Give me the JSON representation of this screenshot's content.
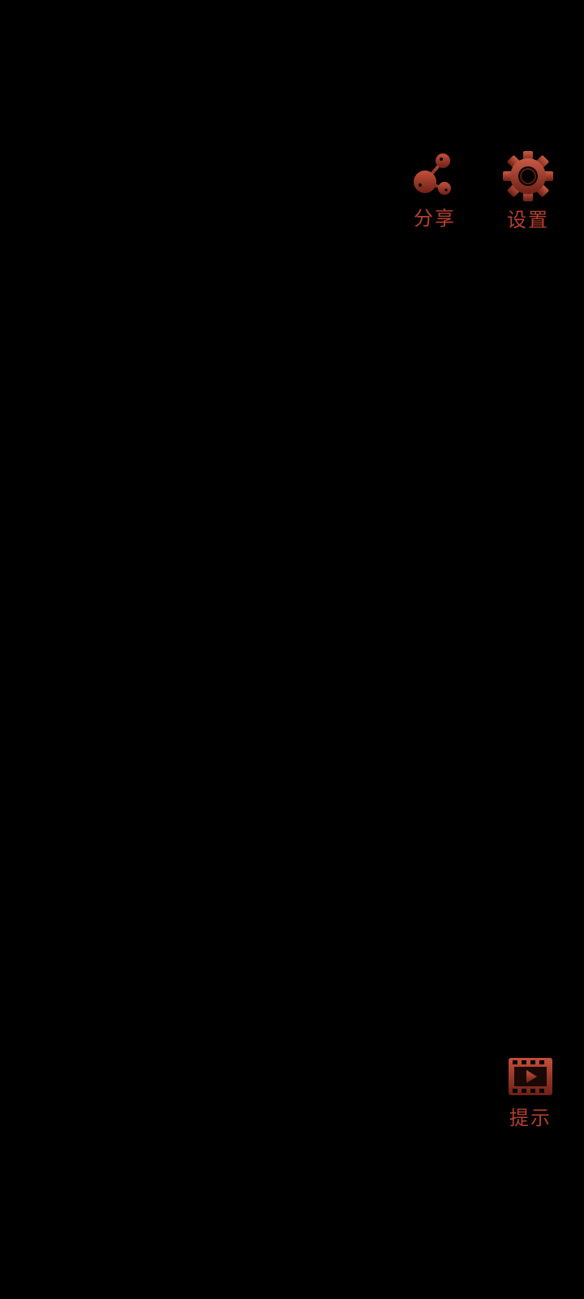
{
  "theme": {
    "background": "#000000",
    "accent": "#b5402f",
    "accent_dark": "#7a2418"
  },
  "top_buttons": {
    "share": {
      "label": "分享",
      "icon": "share-icon"
    },
    "settings": {
      "label": "设置",
      "icon": "gear-icon"
    }
  },
  "bottom_buttons": {
    "hint": {
      "label": "提示",
      "icon": "video-play-icon"
    }
  }
}
